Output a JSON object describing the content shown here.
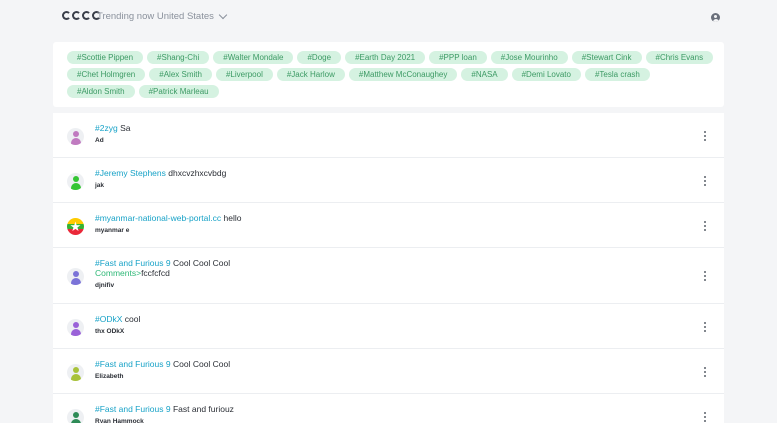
{
  "header": {
    "logo_icon": "cccc-logo-icon",
    "trend_label": "Trending now",
    "region": "United States",
    "account_icon": "user-circle-icon"
  },
  "tags": [
    "#Scottie Pippen",
    "#Shang-Chi",
    "#Walter Mondale",
    "#Doge",
    "#Earth Day 2021",
    "#PPP loan",
    "#Jose Mourinho",
    "#Stewart Cink",
    "#Chris Evans",
    "#Chet Holmgren",
    "#Alex Smith",
    "#Liverpool",
    "#Jack Harlow",
    "#Matthew McConaughey",
    "#NASA",
    "#Demi Lovato",
    "#Tesla crash",
    "#Aldon Smith",
    "#Patrick Marleau"
  ],
  "colors": {
    "accent_link": "#17a2c7",
    "comment_green": "#2fb877",
    "tag_bg": "#d5f2e1",
    "tag_text": "#3c9a64"
  },
  "posts": [
    {
      "hashtag": "#2zyg",
      "text": "Sa",
      "author": "Ad",
      "avatar": "person-icon",
      "avatar_color": "#c07ac0"
    },
    {
      "hashtag": "#Jeremy Stephens",
      "text": "dhxcvzhxcvbdg",
      "author": "jak",
      "avatar": "person-icon",
      "avatar_color": "#34c534"
    },
    {
      "hashtag": "#myanmar-national-web-portal.cc",
      "text": "hello",
      "author": "myanmar e",
      "avatar": "myanmar-flag-icon"
    },
    {
      "hashtag": "#Fast and Furious 9",
      "text": "Cool Cool Cool",
      "comment_prefix": "Comments>",
      "comment": "fccfcfcd",
      "author": "djnifiv",
      "avatar": "person-icon",
      "avatar_color": "#7b73d8"
    },
    {
      "hashtag": "#ODkX",
      "text": "cool",
      "author": "thx ODkX",
      "avatar": "person-icon",
      "avatar_color": "#9a62d8"
    },
    {
      "hashtag": "#Fast and Furious 9",
      "text": "Cool Cool Cool",
      "author": "Elizabeth",
      "avatar": "person-icon",
      "avatar_color": "#a8c23a"
    },
    {
      "hashtag": "#Fast and Furious 9",
      "text": "Fast and furiouz",
      "author": "Ryan Hammock",
      "avatar": "person-icon",
      "avatar_color": "#2e8b57"
    }
  ],
  "post_menu_icon": "more-vertical-icon"
}
